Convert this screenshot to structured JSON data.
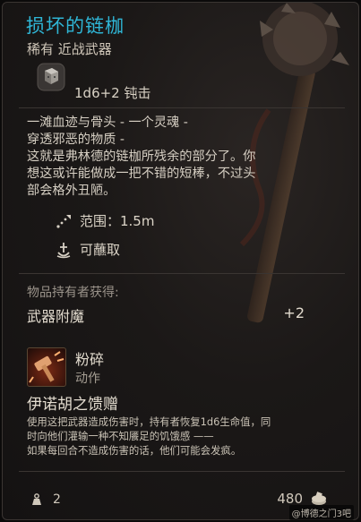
{
  "item": {
    "name": "损坏的链枷",
    "rarity_type": "稀有 近战武器",
    "damage": "1d6+2 钝击",
    "flavor_lines": [
      "一滩血迹与骨头 - 一个灵魂 -",
      "穿透邪恶的物质 -",
      "这就是弗林德的链枷所残余的部分了。你",
      "想这或许能做成一把不错的短棒，不过头",
      "部会格外丑陋。"
    ],
    "range_text": "范围：1.5m",
    "dippable_text": "可蘸取"
  },
  "wielder": {
    "section_label": "物品持有者获得:",
    "enchant_label": "武器附魔",
    "enchant_value": "+2"
  },
  "action": {
    "name": "粉碎",
    "type": "动作"
  },
  "gift": {
    "title": "伊诺胡之馈赠",
    "lines": [
      "使用这把武器造成伤害时，持有者恢复1d6生命值，同",
      "时向他们灌输一种不知餍足的饥饿感 ——",
      "如果每回合不造成伤害的话，他们可能会发疯。"
    ]
  },
  "footer": {
    "weight": "2",
    "value": "480"
  },
  "watermark": "@博德之门3吧",
  "colors": {
    "title": "#2fb6d6",
    "panel_bg": "#1b1817",
    "border": "#3a3532"
  },
  "icons": {
    "damage": "dice-icon",
    "range": "range-icon",
    "dip": "dip-icon",
    "action": "smash-action-icon",
    "weight": "weight-icon",
    "value": "gold-coin-icon"
  }
}
